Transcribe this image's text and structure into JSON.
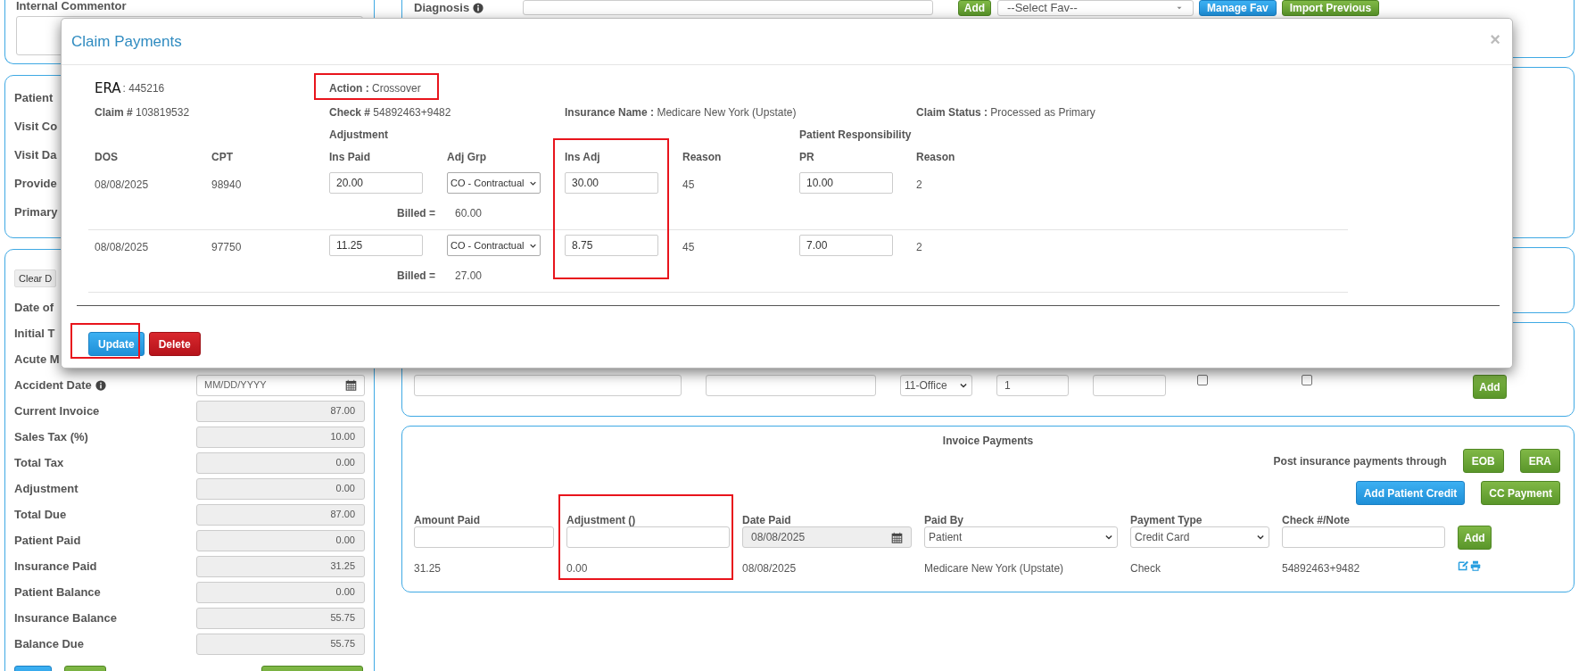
{
  "left_column": {
    "comment_label": "Internal Commentor",
    "visit_labels": [
      "Patient",
      "Visit Co",
      "Visit Da",
      "Provide",
      "Primary"
    ],
    "clear_button": "Clear D",
    "covered_labels": [
      "Date of",
      "Initial T",
      "Acute M"
    ],
    "accident_date": {
      "label": "Accident Date",
      "placeholder": "MM/DD/YYYY"
    },
    "totals": [
      {
        "label": "Current Invoice",
        "value": "87.00"
      },
      {
        "label": "Sales Tax (%)",
        "value": "10.00"
      },
      {
        "label": "Total Tax",
        "value": "0.00"
      },
      {
        "label": "Adjustment",
        "value": "0.00"
      },
      {
        "label": "Total Due",
        "value": "87.00"
      },
      {
        "label": "Patient Paid",
        "value": "0.00"
      },
      {
        "label": "Insurance Paid",
        "value": "31.25"
      },
      {
        "label": "Patient Balance",
        "value": "0.00"
      },
      {
        "label": "Insurance Balance",
        "value": "55.75"
      },
      {
        "label": "Balance Due",
        "value": "55.75"
      }
    ]
  },
  "diagnosis_panel": {
    "label": "Diagnosis",
    "add_button": "Add",
    "fav_select": "--Select Fav--",
    "manage_button": "Manage Fav",
    "import_button": "Import Previous"
  },
  "misc_panel": {
    "pos": "11-Office",
    "units": "1",
    "taxable": {
      "checked": false
    },
    "non_billable": {
      "checked": false
    },
    "add_button": "Add"
  },
  "invoice_payments": {
    "title": "Invoice Payments",
    "post_label": "Post insurance payments through",
    "post_buttons": [
      {
        "label": "EOB",
        "kind": "success"
      },
      {
        "label": "ERA",
        "kind": "success"
      }
    ],
    "action_buttons": [
      {
        "label": "Add Patient Credit",
        "kind": "primary"
      },
      {
        "label": "CC Payment",
        "kind": "success"
      }
    ],
    "fields": [
      {
        "label": "Amount Paid",
        "kind": "text"
      },
      {
        "label": "Adjustment ()",
        "kind": "text"
      },
      {
        "label": "Date Paid",
        "kind": "date",
        "value": "08/08/2025"
      },
      {
        "label": "Paid By",
        "kind": "select",
        "value": "Patient"
      },
      {
        "label": "Payment Type",
        "kind": "select",
        "value": "Credit Card"
      },
      {
        "label": "Check #/Note",
        "kind": "text"
      }
    ],
    "add_button": "Add",
    "payments": [
      {
        "cells": [
          "31.25",
          "0.00",
          "08/08/2025",
          "Medicare New York (Upstate)",
          "Check",
          "54892463+9482"
        ]
      }
    ]
  },
  "modal": {
    "title": "Claim Payments",
    "close": "×",
    "era_label": "ERA",
    "era_value": ": 445216",
    "action": "**Action :** Crossover",
    "info": [
      "**Claim #** 103819532",
      "**Check #** 54892463+9482",
      "**Insurance Name :** Medicare New York (Upstate)",
      "**Claim Status :** Processed as Primary"
    ],
    "group_headings": [
      "Adjustment",
      "Patient Responsibility"
    ],
    "columns": [
      "DOS",
      "CPT",
      "Ins Paid",
      "Adj Grp",
      "Ins Adj",
      "Reason",
      "PR",
      "Reason"
    ],
    "rows": [
      {
        "dos": "08/08/2025",
        "cpt": "98940",
        "ins_paid": "20.00",
        "adj_grp": "CO - Contractual",
        "ins_adj": "30.00",
        "reason": "45",
        "pr": "10.00",
        "pr_reason": "2",
        "billed_label": "Billed =",
        "billed": "60.00"
      },
      {
        "dos": "08/08/2025",
        "cpt": "97750",
        "ins_paid": "11.25",
        "adj_grp": "CO - Contractual",
        "ins_adj": "8.75",
        "reason": "45",
        "pr": "7.00",
        "pr_reason": "2",
        "billed_label": "Billed =",
        "billed": "27.00"
      }
    ],
    "buttons": [
      {
        "label": "Update",
        "kind": "primary"
      },
      {
        "label": "Delete",
        "kind": "danger"
      }
    ]
  }
}
